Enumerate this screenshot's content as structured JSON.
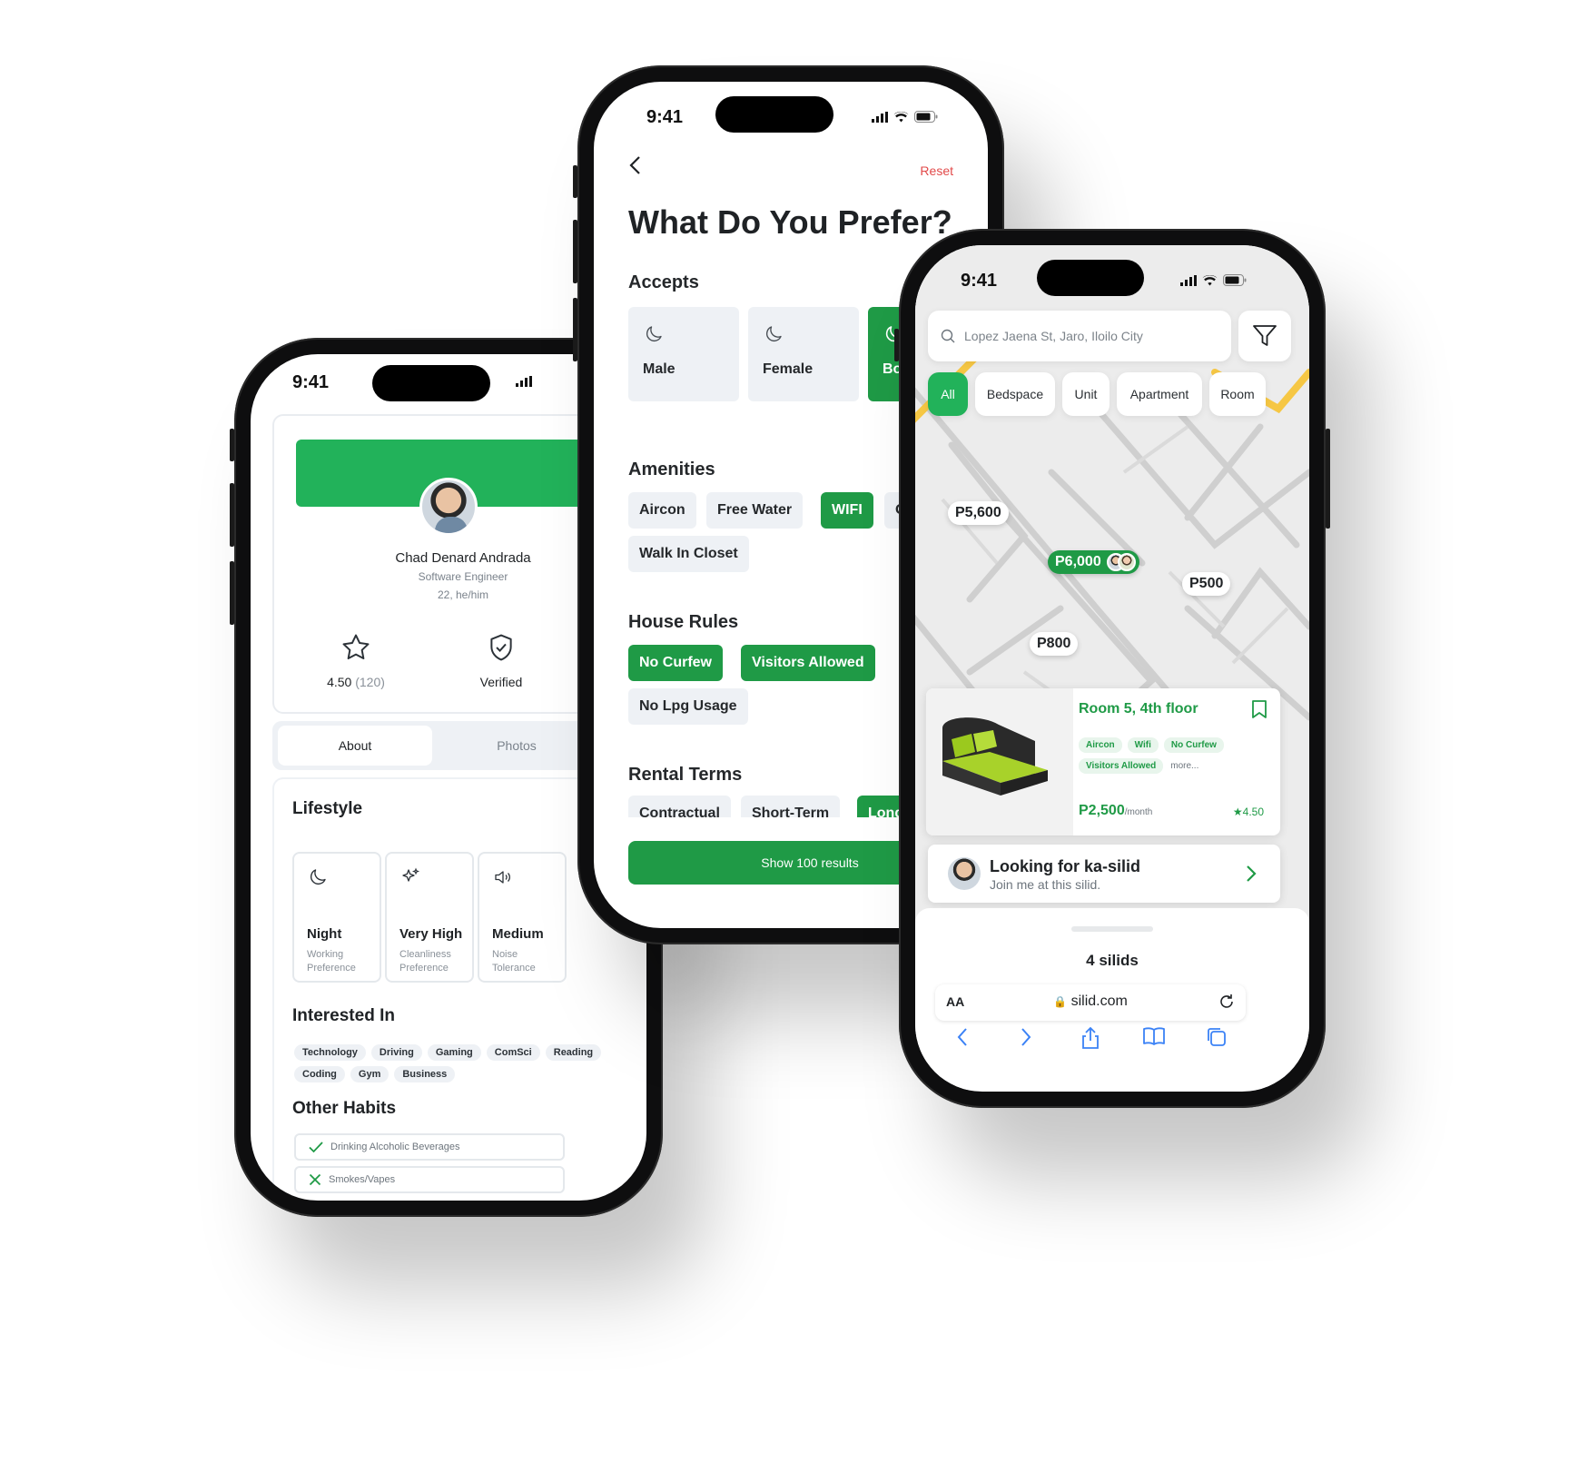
{
  "profile": {
    "time": "9:41",
    "name": "Chad Denard Andrada",
    "role": "Software Engineer",
    "age": "22, he/him",
    "rating": "4.50",
    "rating_count": "(120)",
    "verified": "Verified",
    "tabs": [
      "About",
      "Photos"
    ],
    "lifestyle_title": "Lifestyle",
    "lifestyle": [
      {
        "icon": "moon-icon",
        "value": "Night",
        "label_1": "Working",
        "label_2": "Preference"
      },
      {
        "icon": "sparkles-icon",
        "value": "Very High",
        "label_1": "Cleanliness",
        "label_2": "Preference"
      },
      {
        "icon": "volume-icon",
        "value": "Medium",
        "label_1": "Noise",
        "label_2": "Tolerance"
      }
    ],
    "interests_title": "Interested In",
    "interests": [
      "Technology",
      "Driving",
      "Gaming",
      "ComSci",
      "Reading",
      "Coding",
      "Gym",
      "Business"
    ],
    "habits_title": "Other Habits",
    "habits": [
      {
        "label": "Drinking Alcoholic Beverages",
        "icon": "check-icon"
      },
      {
        "label": "Smokes/Vapes",
        "icon": "x-icon"
      }
    ]
  },
  "prefs": {
    "time": "9:41",
    "reset": "Reset",
    "title": "What Do You Prefer?",
    "accepts_title": "Accepts",
    "accepts": [
      "Male",
      "Female",
      "Both"
    ],
    "accepts_selected": "Both",
    "amenities_title": "Amenities",
    "amenities": [
      "Aircon",
      "Free Water",
      "WIFI",
      "Own",
      "Walk In Closet"
    ],
    "amenities_selected": [
      "WIFI"
    ],
    "rules_title": "House Rules",
    "rules": [
      "No Curfew",
      "Visitors Allowed",
      "No Lpg Usage"
    ],
    "rules_selected": [
      "No Curfew",
      "Visitors Allowed"
    ],
    "terms_title": "Rental Terms",
    "terms": [
      "Contractual",
      "Short-Term",
      "Long-T"
    ],
    "terms_selected": [
      "Long-T"
    ],
    "show_button": "Show 100 results",
    "accent": "#1f9a46"
  },
  "map": {
    "time": "9:41",
    "search_value": "Lopez Jaena St, Jaro, Iloilo City",
    "categories": [
      "All",
      "Bedspace",
      "Unit",
      "Apartment",
      "Room"
    ],
    "category_selected": "All",
    "pins": [
      "P5,600",
      "P6,000",
      "P500",
      "P800"
    ],
    "pin_selected": "P6,000",
    "listing": {
      "title": "Room 5, 4th floor",
      "tags": [
        "Aircon",
        "Wifi",
        "No Curfew",
        "Visitors Allowed"
      ],
      "more": "more...",
      "price": "P2,500",
      "per": "/month",
      "rating": "4.50"
    },
    "looking": {
      "title": "Looking for ka-silid",
      "subtitle": "Join me at this silid."
    },
    "count": "4 silids",
    "browser": {
      "aa": "AA",
      "url": "silid.com"
    },
    "brand_green": "#22b25a",
    "road_yellow": "#f6c744"
  }
}
